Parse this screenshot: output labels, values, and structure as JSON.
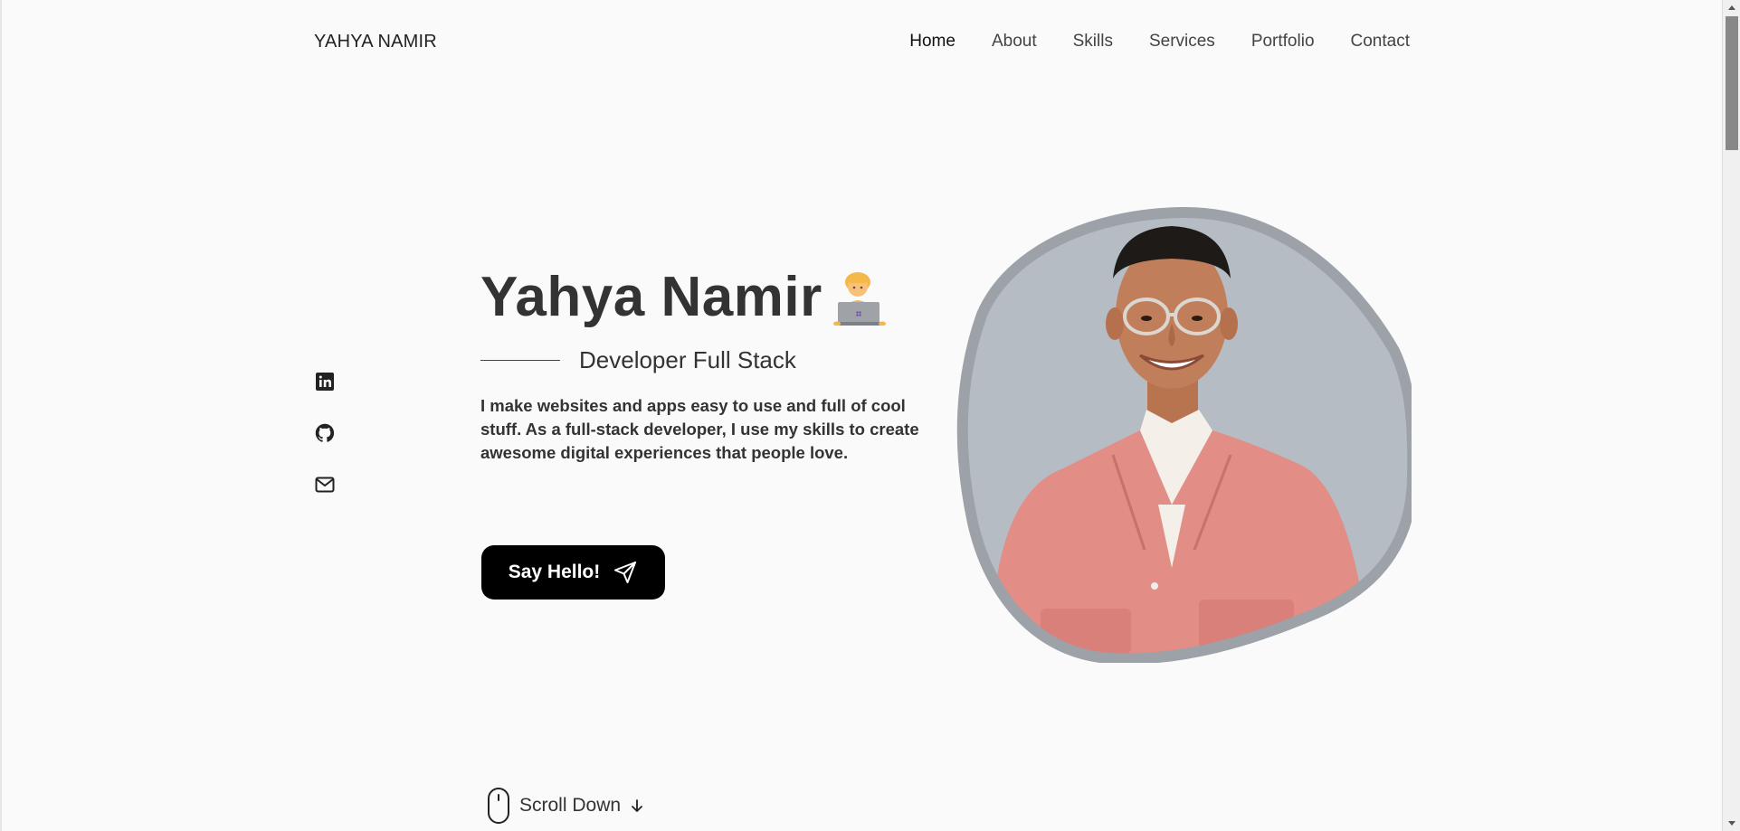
{
  "header": {
    "logo": "YAHYA NAMIR",
    "nav": [
      {
        "label": "Home",
        "active": true
      },
      {
        "label": "About"
      },
      {
        "label": "Skills"
      },
      {
        "label": "Services"
      },
      {
        "label": "Portfolio"
      },
      {
        "label": "Contact"
      }
    ]
  },
  "social": [
    {
      "icon": "linkedin-icon"
    },
    {
      "icon": "github-icon"
    },
    {
      "icon": "mail-icon"
    }
  ],
  "hero": {
    "name": "Yahya Namir",
    "emoji": "technologist-emoji",
    "subtitle": "Developer Full Stack",
    "description": "I make websites and apps easy to use and full of cool stuff. As a full-stack developer, I use my skills to create awesome digital experiences that people love.",
    "cta_label": "Say Hello!",
    "cta_icon": "send-icon"
  },
  "scroll": {
    "label": "Scroll Down",
    "icon": "mouse-icon",
    "arrow_icon": "arrow-down-icon"
  },
  "colors": {
    "background": "#fafafa",
    "text": "#333333",
    "button": "#000000",
    "blob": "#b5bbc2",
    "blob_border": "#9aa0a6"
  }
}
